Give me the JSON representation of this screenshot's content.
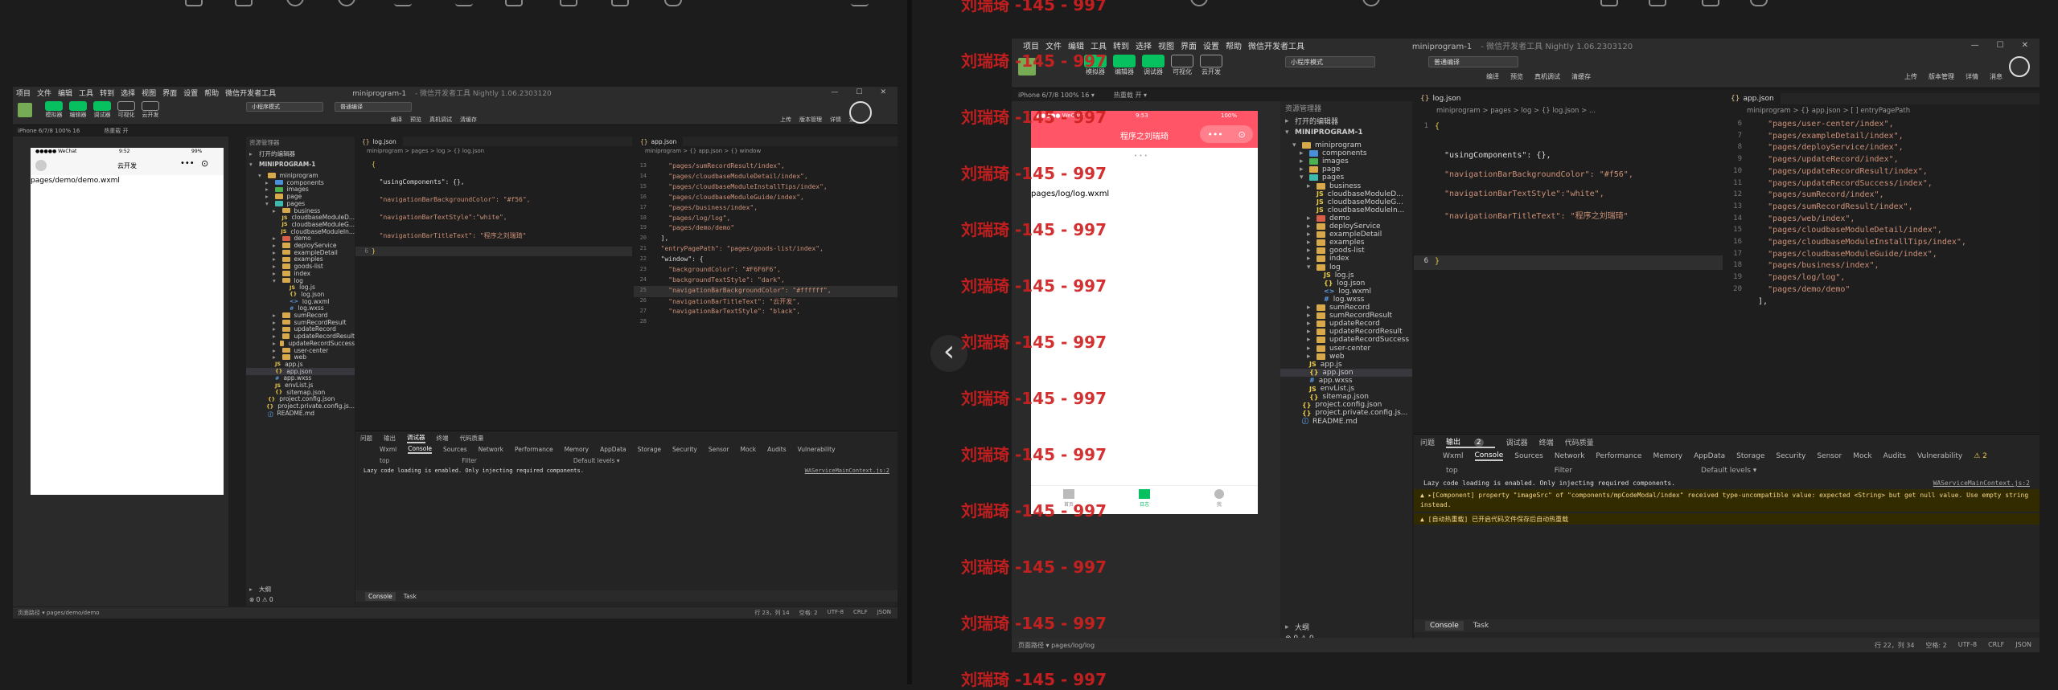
{
  "window": {
    "title": "miniprogram-1",
    "subtitle": "- 微信开发者工具 Nightly 1.06.2303120",
    "menu": [
      "项目",
      "文件",
      "编辑",
      "工具",
      "转到",
      "选择",
      "视图",
      "界面",
      "设置",
      "帮助",
      "微信开发者工具"
    ]
  },
  "toolbar": {
    "buttons": [
      "模拟器",
      "编辑器",
      "调试器",
      "可视化",
      "云开发"
    ],
    "mode_select": "小程序模式",
    "compile_select": "普通编译",
    "actions": [
      "编译",
      "预览",
      "真机调试",
      "清缓存"
    ],
    "right_buttons": [
      "上传",
      "版本管理",
      "详情",
      "消息"
    ]
  },
  "left_window": {
    "device": "iPhone 6/7/8 100% 16",
    "hotreload": "热重载 开",
    "sim": {
      "carrier": "●●●●● WeChat",
      "time": "9:52",
      "battery": "99%",
      "nav_title": "云开发",
      "page_path": "pages/demo/demo.wxml"
    },
    "tree": {
      "header": "资源管理器",
      "open_editors": "打开的编辑器",
      "project": "MINIPROGRAM-1",
      "items": [
        "miniprogram",
        "components",
        "images",
        "page",
        "pages",
        "business",
        "cloudbaseModuleD...",
        "cloudbaseModuleG...",
        "cloudbaseModuleIn...",
        "demo",
        "deployService",
        "exampleDetail",
        "examples",
        "goods-list",
        "index",
        "log",
        "log.js",
        "log.json",
        "log.wxml",
        "log.wxss",
        "sumRecord",
        "sumRecordResult",
        "updateRecord",
        "updateRecordResult",
        "updateRecordSuccess",
        "user-center",
        "web",
        "app.js",
        "app.json",
        "app.wxss",
        "envList.js",
        "sitemap.json",
        "project.config.json",
        "project.private.config.js...",
        "README.md"
      ],
      "outline": "大纲",
      "problems": "⊗ 0 ⚠ 0"
    },
    "editor_left": {
      "tab": "log.json",
      "breadcrumb": "miniprogram > pages > log > {} log.json",
      "lines": [
        "{",
        "  \"usingComponents\": {},",
        "  \"navigationBarBackgroundColor\": \"#f56\",",
        "  \"navigationBarTextStyle\":\"white\",",
        "  \"navigationBarTitleText\": \"程序之刘瑞琦\"",
        "}"
      ]
    },
    "editor_right": {
      "tab": "app.json",
      "breadcrumb": "miniprogram > {} app.json > {} window",
      "line_numbers": [
        "13",
        "14",
        "15",
        "16",
        "17",
        "18",
        "19",
        "20",
        "21",
        "22",
        "23",
        "24",
        "25",
        "26",
        "27",
        "28"
      ],
      "lines": [
        "    \"pages/sumRecordResult/index\",",
        "    \"pages/cloudbaseModuleDetail/index\",",
        "    \"pages/cloudbaseModuleInstallTips/index\",",
        "    \"pages/cloudbaseModuleGuide/index\",",
        "    \"pages/business/index\",",
        "    \"pages/log/log\",",
        "    \"pages/demo/demo\"",
        "  ],",
        "  \"entryPagePath\": \"pages/goods-list/index\",",
        "  \"window\": {",
        "    \"backgroundColor\": \"#F6F6F6\",",
        "    \"backgroundTextStyle\": \"dark\",",
        "    \"navigationBarBackgroundColor\": \"#ffffff\",",
        "    \"navigationBarTitleText\": \"云开发\",",
        "    \"navigationBarTextStyle\": \"black\","
      ]
    },
    "devtools": {
      "tabs": [
        "问题",
        "输出",
        "调试器",
        "终端",
        "代码质量"
      ],
      "panels": [
        "Wxml",
        "Console",
        "Sources",
        "Network",
        "Performance",
        "Memory",
        "AppData",
        "Storage",
        "Security",
        "Sensor",
        "Mock",
        "Audits",
        "Vulnerability"
      ],
      "context": "top",
      "filter": "Filter",
      "levels": "Default levels ▾",
      "message": "Lazy code loading is enabled. Only injecting required components.",
      "source": "WAServiceMainContext.js:2",
      "bottom_tabs": [
        "Console",
        "Task"
      ]
    },
    "status": {
      "path": "页面路径 ▾   pages/demo/demo",
      "position": "行 23，列 14",
      "spaces": "空格: 2",
      "encoding": "UTF-8",
      "eol": "CRLF",
      "lang": "JSON"
    }
  },
  "right_window": {
    "device": "iPhone 6/7/8 100% 16 ▾",
    "hotreload": "热重载 开 ▾",
    "sim": {
      "carrier": "●●●●● WeChat",
      "time": "9:53",
      "battery": "100%",
      "nav_title": "程序之刘瑞琦",
      "page_path": "pages/log/log.wxml",
      "tabbar": [
        "首页",
        "日志",
        "我"
      ]
    },
    "tree": {
      "header": "资源管理器",
      "open_editors": "打开的编辑器",
      "project": "MINIPROGRAM-1",
      "items": [
        "miniprogram",
        "components",
        "images",
        "page",
        "pages",
        "business",
        "cloudbaseModuleD...",
        "cloudbaseModuleG...",
        "cloudbaseModuleIn...",
        "demo",
        "deployService",
        "exampleDetail",
        "examples",
        "goods-list",
        "index",
        "log",
        "log.js",
        "log.json",
        "log.wxml",
        "log.wxss",
        "sumRecord",
        "sumRecordResult",
        "updateRecord",
        "updateRecordResult",
        "updateRecordSuccess",
        "user-center",
        "web",
        "app.js",
        "app.json",
        "app.wxss",
        "envList.js",
        "sitemap.json",
        "project.config.json",
        "project.private.config.js...",
        "README.md"
      ],
      "outline": "大纲",
      "problems": "⊗ 0 ⚠ 0"
    },
    "editor_left": {
      "tab": "log.json",
      "breadcrumb": "miniprogram > pages > log > {} log.json > ...",
      "lines": [
        "{",
        "  \"usingComponents\": {},",
        "  \"navigationBarBackgroundColor\": \"#f56\",",
        "  \"navigationBarTextStyle\":\"white\",",
        "  \"navigationBarTitleText\": \"程序之刘瑞琦\"",
        "}"
      ]
    },
    "editor_right": {
      "tab": "app.json",
      "breadcrumb": "miniprogram > {} app.json > [ ] entryPagePath",
      "line_numbers": [
        "6",
        "7",
        "8",
        "9",
        "10",
        "11",
        "12",
        "13",
        "14",
        "15",
        "16",
        "17",
        "18",
        "19",
        "20"
      ],
      "lines": [
        "    \"pages/user-center/index\",",
        "    \"pages/exampleDetail/index\",",
        "    \"pages/deployService/index\",",
        "    \"pages/updateRecord/index\",",
        "    \"pages/updateRecordResult/index\",",
        "    \"pages/updateRecordSuccess/index\",",
        "    \"pages/sumRecord/index\",",
        "    \"pages/sumRecordResult/index\",",
        "    \"pages/web/index\",",
        "    \"pages/cloudbaseModuleDetail/index\",",
        "    \"pages/cloudbaseModuleInstallTips/index\",",
        "    \"pages/cloudbaseModuleGuide/index\",",
        "    \"pages/business/index\",",
        "    \"pages/log/log\",",
        "    \"pages/demo/demo\"",
        "  ],"
      ]
    },
    "devtools": {
      "tabs": [
        "问题",
        "输出",
        "调试器",
        "终端",
        "代码质量"
      ],
      "badge": "2",
      "panels": [
        "Wxml",
        "Console",
        "Sources",
        "Network",
        "Performance",
        "Memory",
        "AppData",
        "Storage",
        "Security",
        "Sensor",
        "Mock",
        "Audits",
        "Vulnerability"
      ],
      "warn_count": "⚠ 2",
      "context": "top",
      "filter": "Filter",
      "levels": "Default levels ▾",
      "message": "Lazy code loading is enabled. Only injecting required components.",
      "source": "WAServiceMainContext.js:2",
      "warn1": "▲ ▸[Component] property \"imageSrc\" of \"components/mpCodeModal/index\" received type-uncompatible value: expected <String> but get null value. Use empty string instead.",
      "warn2": "▲ [自动热重载] 已开启代码文件保存后自动热重载",
      "bottom_tabs": [
        "Console",
        "Task"
      ]
    },
    "status": {
      "path": "页面路径 ▾   pages/log/log",
      "position": "行 22，列 34",
      "spaces": "空格: 2",
      "encoding": "UTF-8",
      "eol": "CRLF",
      "lang": "JSON"
    }
  },
  "watermark": "刘瑞琦 -145 - 997",
  "nav_prev": "‹",
  "colors": {
    "accent_green": "#07c160",
    "sim_nav_red": "#ff5566",
    "watermark_red": "#d02020"
  }
}
